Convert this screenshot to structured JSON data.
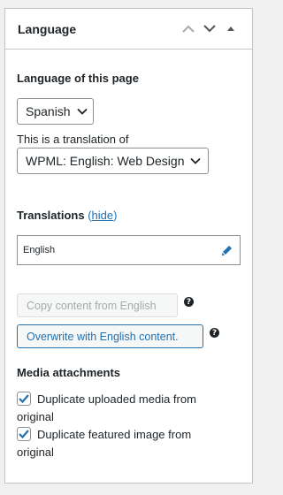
{
  "panel": {
    "title": "Language",
    "move_up_label": "Move up",
    "move_down_label": "Move down",
    "toggle_label": "Toggle panel"
  },
  "language_section": {
    "heading": "Language of this page",
    "selected_language": "Spanish",
    "translation_of_label": "This is a translation of",
    "translation_of_value": "WPML: English: Web Design"
  },
  "translations": {
    "heading": "Translations",
    "open_paren": "(",
    "hide_link": "hide",
    "close_paren": ")",
    "items": [
      {
        "language": "English"
      }
    ]
  },
  "actions": {
    "copy_button": "Copy content from English",
    "overwrite_button": "Overwrite with English content.",
    "help_glyph": "?"
  },
  "media": {
    "heading": "Media attachments",
    "options": [
      {
        "label_line1": "Duplicate uploaded media from",
        "label_line2": "original",
        "checked": true
      },
      {
        "label_line1": "Duplicate featured image from",
        "label_line2": "original",
        "checked": true
      }
    ]
  },
  "colors": {
    "link": "#2271b1",
    "text": "#1d2327",
    "border": "#c3c4c7",
    "disabled_text": "#a7aaad"
  }
}
